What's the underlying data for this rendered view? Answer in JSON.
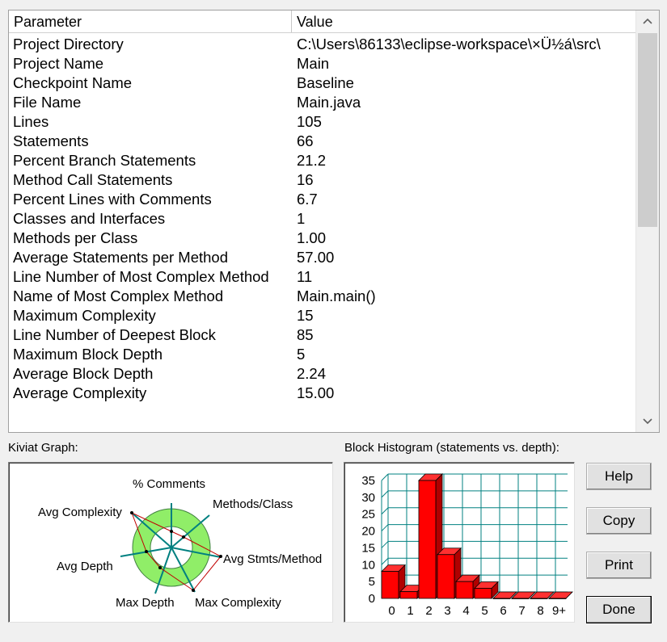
{
  "table": {
    "col_param": "Parameter",
    "col_value": "Value",
    "rows": [
      {
        "param": "Project Directory",
        "value": "C:\\Users\\86133\\eclipse-workspace\\×Ü½á\\src\\"
      },
      {
        "param": "Project Name",
        "value": "Main"
      },
      {
        "param": "Checkpoint Name",
        "value": "Baseline"
      },
      {
        "param": "File Name",
        "value": "Main.java"
      },
      {
        "param": "Lines",
        "value": "105"
      },
      {
        "param": "Statements",
        "value": "66"
      },
      {
        "param": "Percent Branch Statements",
        "value": "21.2"
      },
      {
        "param": "Method Call Statements",
        "value": "16"
      },
      {
        "param": "Percent Lines with Comments",
        "value": "6.7"
      },
      {
        "param": "Classes and Interfaces",
        "value": "1"
      },
      {
        "param": "Methods per Class",
        "value": "1.00"
      },
      {
        "param": "Average Statements per Method",
        "value": "57.00"
      },
      {
        "param": "Line Number of Most Complex Method",
        "value": "11"
      },
      {
        "param": "Name of Most Complex Method",
        "value": "Main.main()"
      },
      {
        "param": "Maximum Complexity",
        "value": "15"
      },
      {
        "param": "Line Number of Deepest Block",
        "value": "85"
      },
      {
        "param": "Maximum Block Depth",
        "value": "5"
      },
      {
        "param": "Average Block Depth",
        "value": "2.24"
      },
      {
        "param": "Average Complexity",
        "value": "15.00"
      }
    ]
  },
  "kiviat": {
    "label": "Kiviat Graph:",
    "axes": [
      "% Comments",
      "Methods/Class",
      "Avg Stmts/Method",
      "Max Complexity",
      "Max Depth",
      "Avg Depth",
      "Avg Complexity"
    ]
  },
  "histogram": {
    "label": "Block Histogram (statements vs. depth):"
  },
  "buttons": {
    "help": "Help",
    "copy": "Copy",
    "print": "Print",
    "done": "Done"
  },
  "chart_data": {
    "type": "bar",
    "categories": [
      "0",
      "1",
      "2",
      "3",
      "4",
      "5",
      "6",
      "7",
      "8",
      "9+"
    ],
    "values": [
      8,
      2,
      35,
      13,
      5,
      3,
      0,
      0,
      0,
      0
    ],
    "ylim": [
      0,
      35
    ],
    "yticks": [
      0,
      5,
      10,
      15,
      20,
      25,
      30,
      35
    ],
    "bar_color": "#ff0000",
    "grid_color": "#008080",
    "grid": true
  }
}
